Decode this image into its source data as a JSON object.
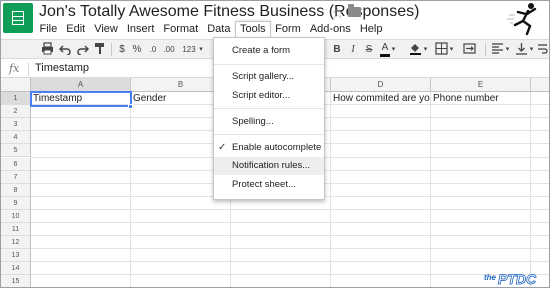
{
  "app": {
    "title": "Jon's Totally Awesome Fitness Business (Responses)"
  },
  "menubar": [
    "File",
    "Edit",
    "View",
    "Insert",
    "Format",
    "Data",
    "Tools",
    "Form",
    "Add-ons",
    "Help"
  ],
  "toolbar": {
    "currency": "$",
    "percent": "%",
    "dec_decrease": ".0",
    "dec_increase": ".00",
    "more_formats": "123",
    "bold": "B",
    "italic": "I",
    "strikethrough": "S",
    "text_color_letter": "A"
  },
  "formula_bar": {
    "fx": "fx",
    "value": "Timestamp"
  },
  "grid": {
    "columns": [
      "A",
      "B",
      "C",
      "D",
      "E"
    ],
    "rows": [
      "1",
      "2",
      "3",
      "4",
      "5",
      "6",
      "7",
      "8",
      "9",
      "10",
      "11",
      "12",
      "13",
      "14",
      "15"
    ],
    "row1": [
      "Timestamp",
      "Gender",
      "",
      "How commited are you to",
      "Phone number"
    ]
  },
  "tools_menu": {
    "items": [
      "Create a form",
      "Script gallery...",
      "Script editor...",
      "Spelling...",
      "Enable autocomplete",
      "Notification rules...",
      "Protect sheet..."
    ],
    "checked_item": "Enable autocomplete",
    "hovered_item": "Notification rules..."
  },
  "watermark": {
    "prefix": "the",
    "name": "PTDC"
  },
  "colors": {
    "sheets_green": "#0f9d58",
    "selection_blue": "#4a7ef3",
    "watermark_blue": "#1f66c1"
  }
}
